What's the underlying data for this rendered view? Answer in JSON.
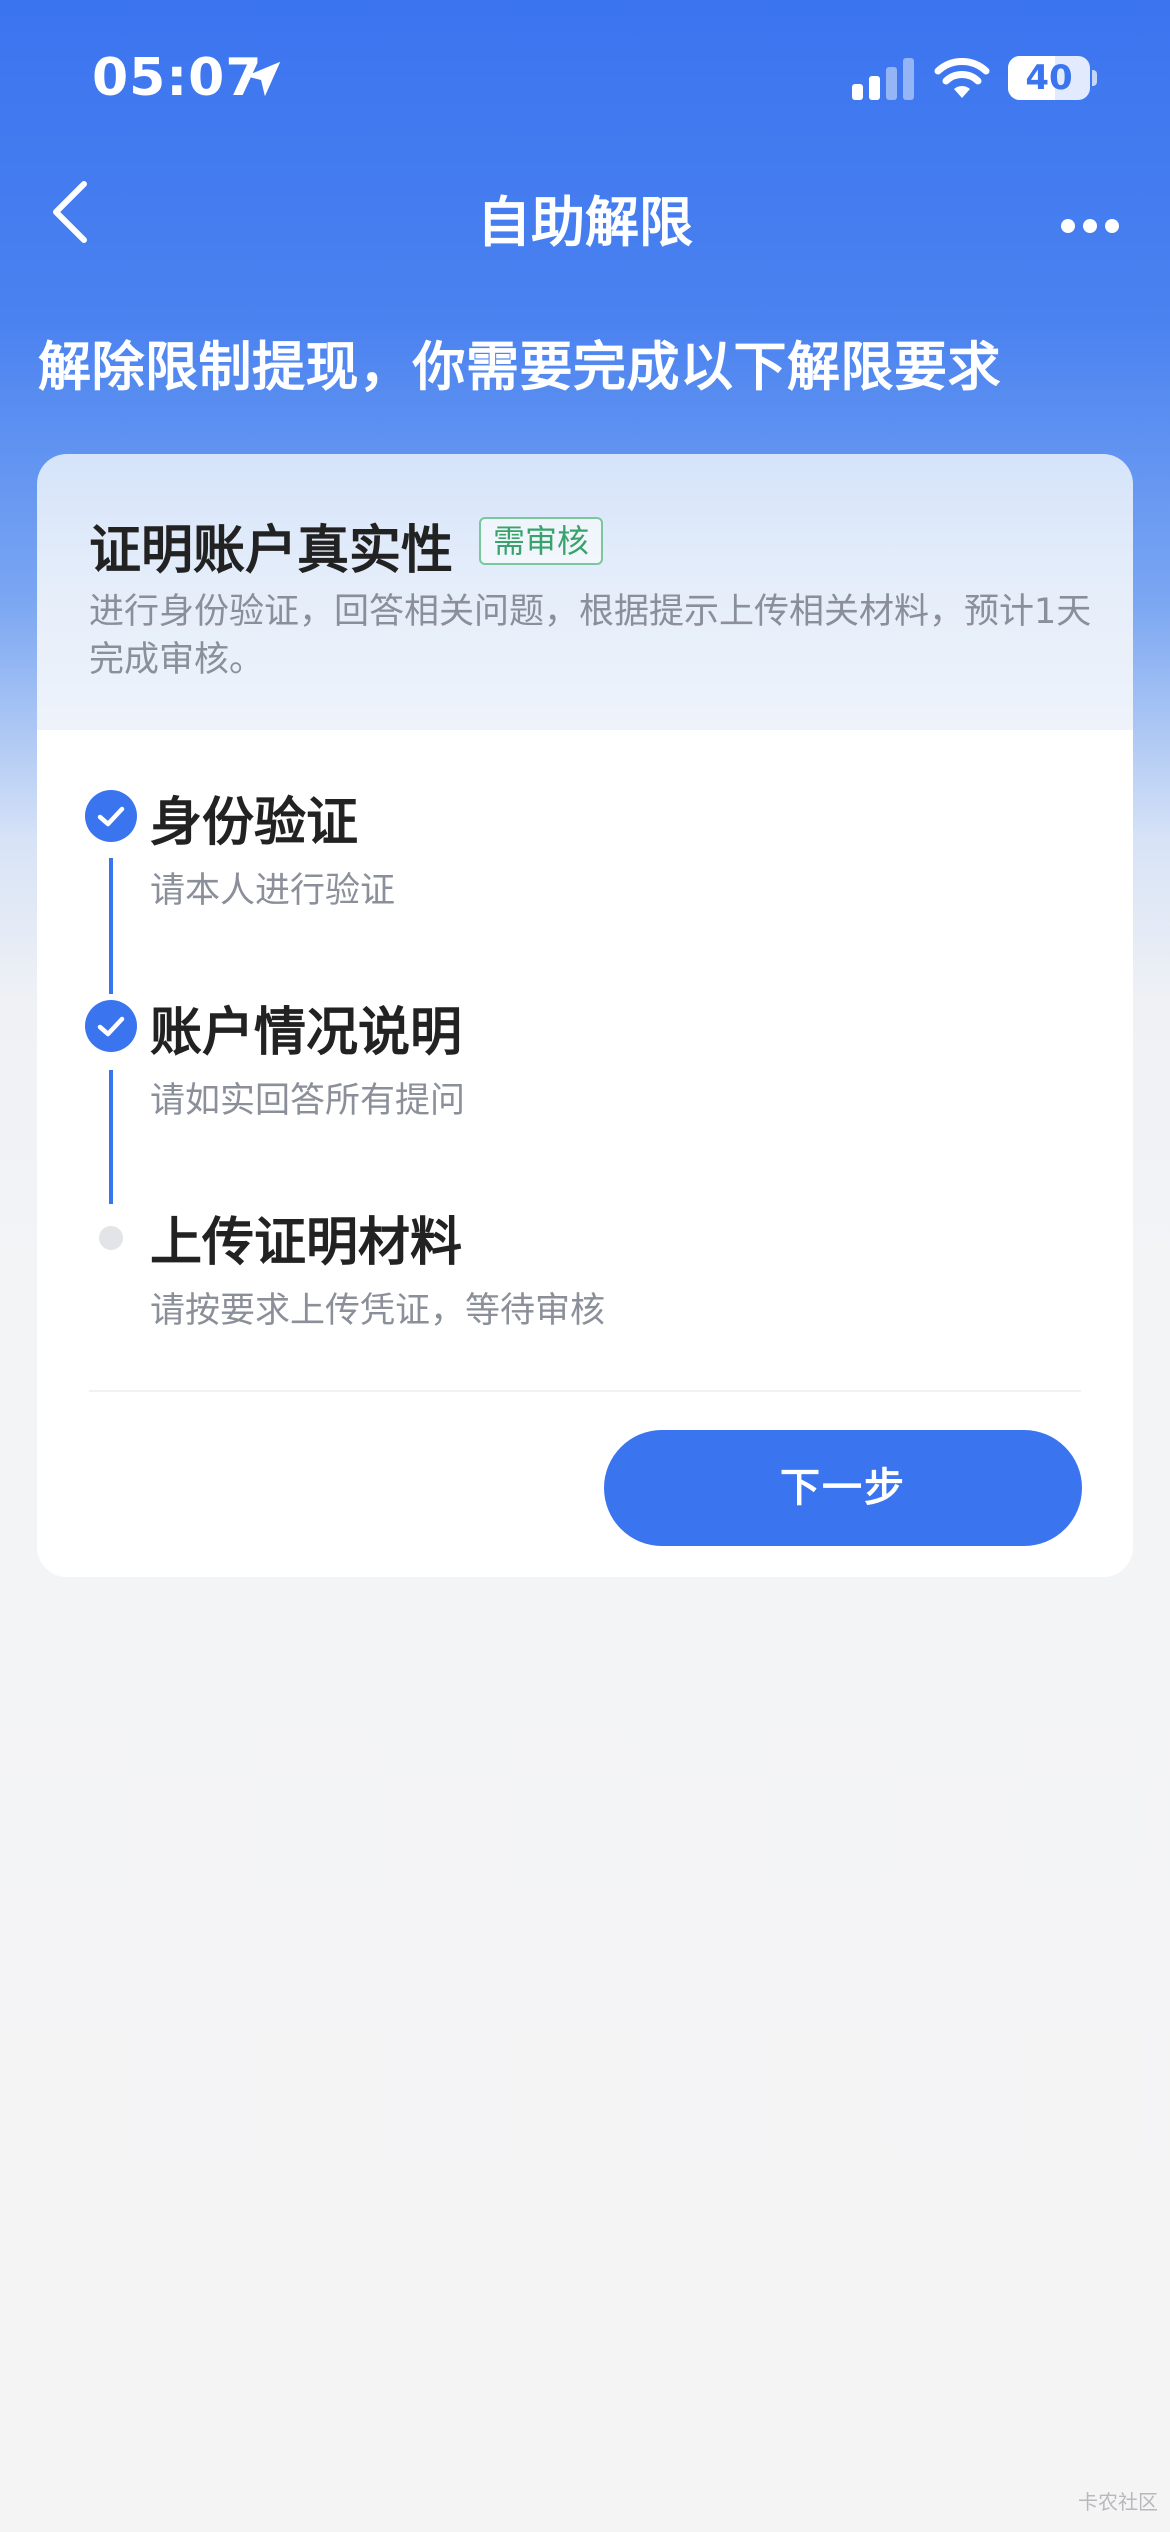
{
  "status_bar": {
    "time": "05:07",
    "battery": "40"
  },
  "nav": {
    "title": "自助解限",
    "back_icon": "chevron-left-icon",
    "more_icon": "more-dots-icon"
  },
  "headline": "解除限制提现，你需要完成以下解限要求",
  "card": {
    "title": "证明账户真实性",
    "badge": "需审核",
    "description": "进行身份验证，回答相关问题，根据提示上传相关材料，预计1天完成审核。",
    "steps": [
      {
        "title": "身份验证",
        "subtitle": "请本人进行验证",
        "status": "done"
      },
      {
        "title": "账户情况说明",
        "subtitle": "请如实回答所有提问",
        "status": "done"
      },
      {
        "title": "上传证明材料",
        "subtitle": "请按要求上传凭证，等待审核",
        "status": "pending"
      }
    ],
    "next_button": "下一步"
  },
  "watermark": "卡农社区",
  "colors": {
    "primary": "#3b74ef",
    "badge_green": "#3aa36b",
    "muted_text": "#8a8f99"
  }
}
